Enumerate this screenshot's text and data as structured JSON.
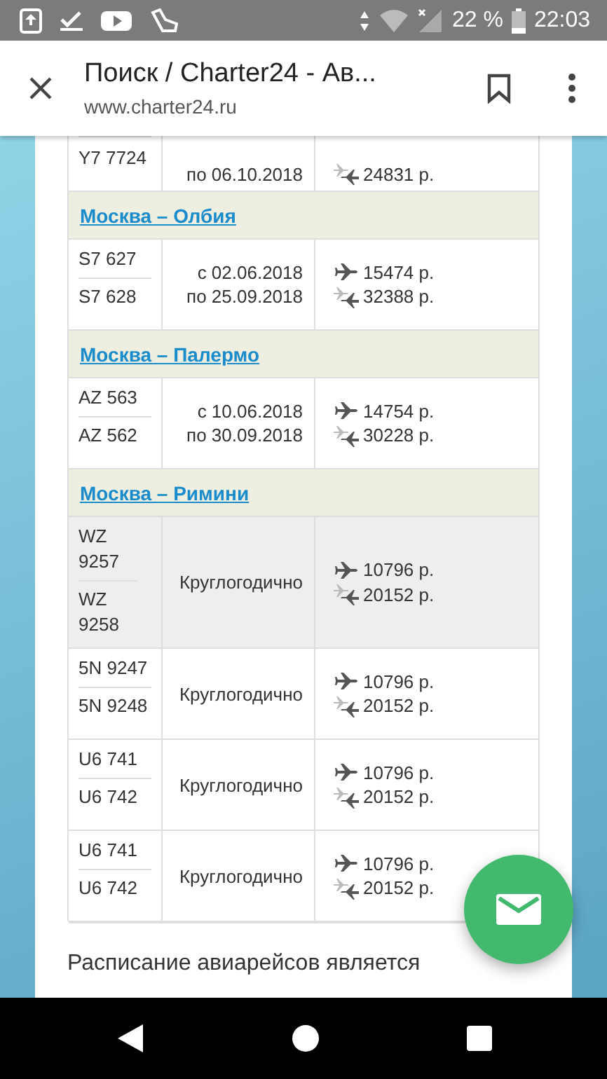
{
  "status_bar": {
    "battery_text": "22 %",
    "time": "22:03"
  },
  "toolbar": {
    "title": "Поиск / Charter24 - Ав...",
    "url": "www.charter24.ru"
  },
  "groups": [
    {
      "rows": [
        {
          "flights": [
            "Y7 7724"
          ],
          "dates": [
            "по 06.10.2018"
          ],
          "prices": [
            {
              "kind": "return",
              "text": "24831 р."
            }
          ],
          "highlighted": false
        }
      ]
    },
    {
      "route": "Москва – Олбия",
      "rows": [
        {
          "flights": [
            "S7 627",
            "S7 628"
          ],
          "dates": [
            "с 02.06.2018",
            "по 25.09.2018"
          ],
          "prices": [
            {
              "kind": "oneway",
              "text": "15474 р."
            },
            {
              "kind": "return",
              "text": "32388 р."
            }
          ],
          "highlighted": false
        }
      ]
    },
    {
      "route": "Москва – Палермо",
      "rows": [
        {
          "flights": [
            "AZ 563",
            "AZ 562"
          ],
          "dates": [
            "с 10.06.2018",
            "по 30.09.2018"
          ],
          "prices": [
            {
              "kind": "oneway",
              "text": "14754 р."
            },
            {
              "kind": "return",
              "text": "30228 р."
            }
          ],
          "highlighted": false
        }
      ]
    },
    {
      "route": "Москва – Римини",
      "rows": [
        {
          "flights": [
            "WZ 9257",
            "WZ 9258"
          ],
          "dates": [
            "Круглогодично"
          ],
          "prices": [
            {
              "kind": "oneway",
              "text": "10796 р."
            },
            {
              "kind": "return",
              "text": "20152 р."
            }
          ],
          "highlighted": true
        },
        {
          "flights": [
            "5N 9247",
            "5N 9248"
          ],
          "dates": [
            "Круглогодично"
          ],
          "prices": [
            {
              "kind": "oneway",
              "text": "10796 р."
            },
            {
              "kind": "return",
              "text": "20152 р."
            }
          ],
          "highlighted": false
        },
        {
          "flights": [
            "U6 741",
            "U6 742"
          ],
          "dates": [
            "Круглогодично"
          ],
          "prices": [
            {
              "kind": "oneway",
              "text": "10796 р."
            },
            {
              "kind": "return",
              "text": "20152 р."
            }
          ],
          "highlighted": false
        },
        {
          "flights": [
            "U6 741",
            "U6 742"
          ],
          "dates": [
            "Круглогодично"
          ],
          "prices": [
            {
              "kind": "oneway",
              "text": "10796 р."
            },
            {
              "kind": "return",
              "text": "20152 р."
            }
          ],
          "highlighted": false
        }
      ]
    }
  ],
  "footer_text": "Расписание авиарейсов является"
}
